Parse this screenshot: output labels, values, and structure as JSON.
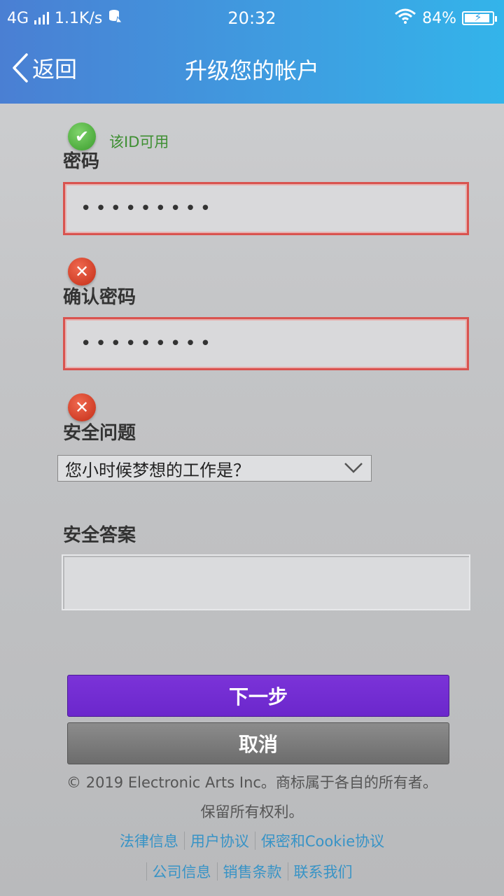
{
  "status_bar": {
    "network": "4G",
    "speed": "1.1K/s",
    "time": "20:32",
    "battery_percent": "84%",
    "battery_level": 0.84
  },
  "nav": {
    "back_label": "返回",
    "title": "升级您的帐户"
  },
  "form": {
    "id_status": "该ID可用",
    "password_label": "密码",
    "password_value": "•••••••••",
    "confirm_label": "确认密码",
    "confirm_value": "•••••••••",
    "question_label": "安全问题",
    "question_selected": "您小时候梦想的工作是？",
    "answer_label": "安全答案",
    "answer_value": ""
  },
  "buttons": {
    "next": "下一步",
    "cancel": "取消"
  },
  "footer": {
    "copyright": "© 2019 Electronic Arts Inc。商标属于各自的所有者。",
    "rights": "保留所有权利。",
    "links_row1": [
      "法律信息",
      "用户协议",
      "保密和Cookie协议"
    ],
    "links_row2": [
      "公司信息",
      "销售条款",
      "联系我们"
    ]
  },
  "colors": {
    "header_start": "#4a7fd3",
    "header_end": "#33b4ea",
    "error_border": "#d9534f",
    "primary_button": "#7b33d8",
    "link": "#3793c6",
    "valid_text": "#3e8f32"
  }
}
